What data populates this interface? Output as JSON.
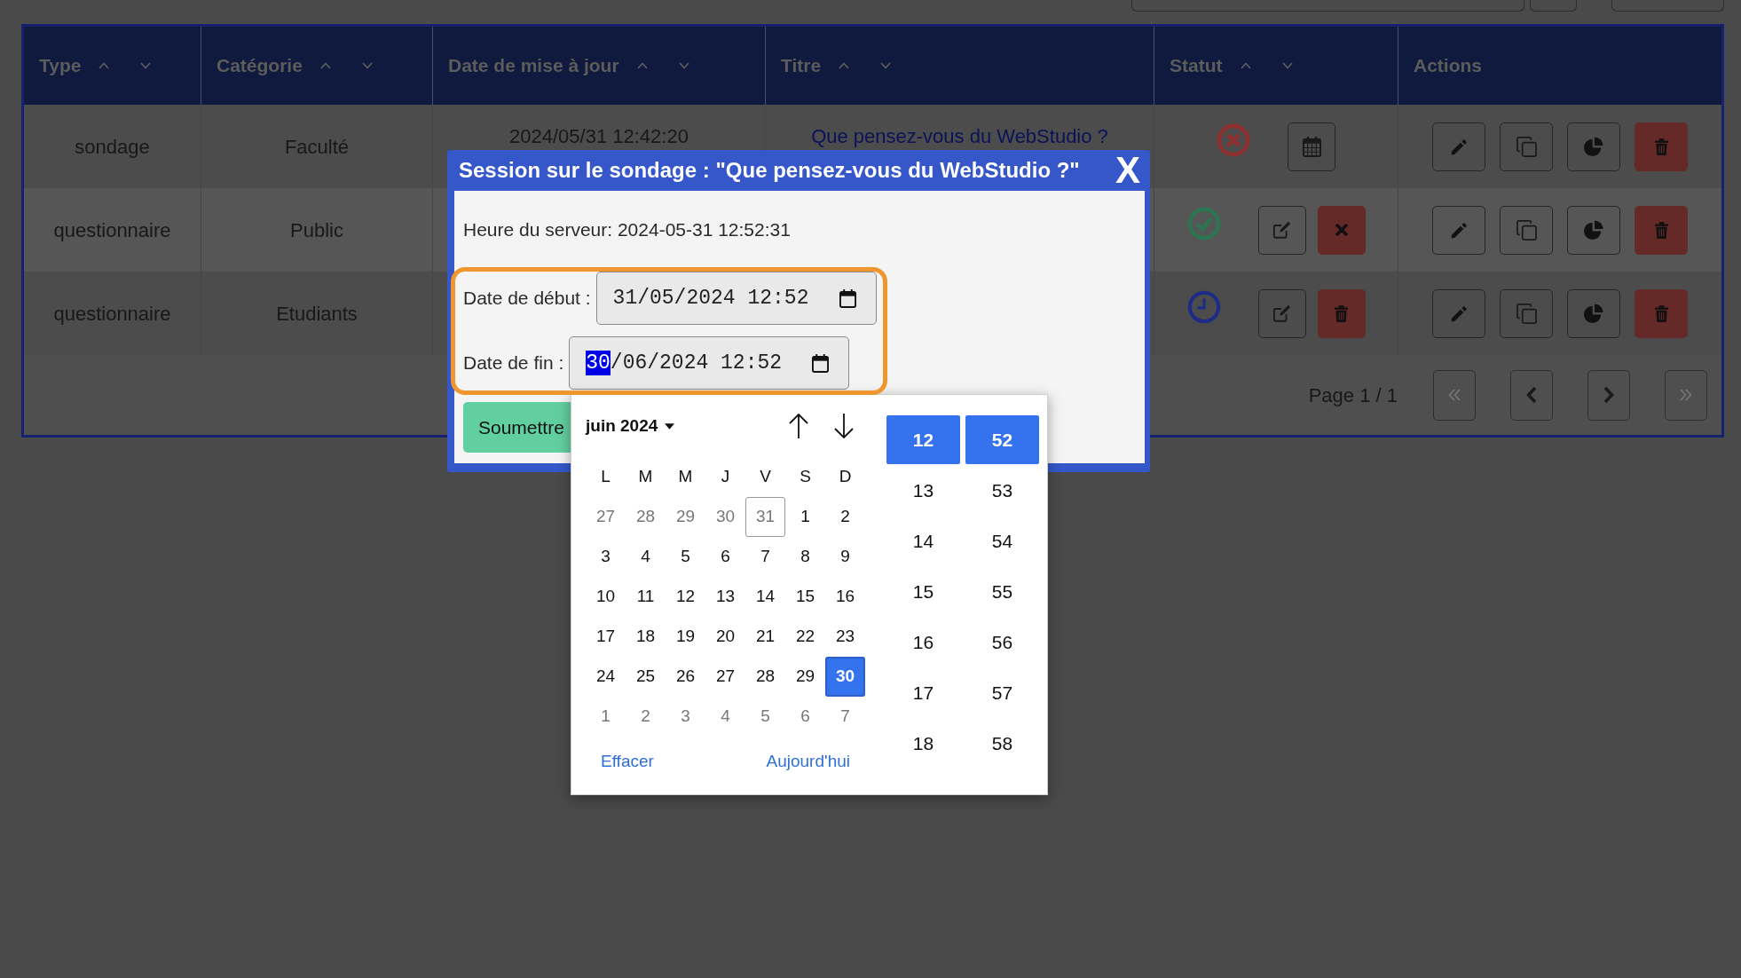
{
  "table": {
    "columns": [
      {
        "label": "Type",
        "sortable": true
      },
      {
        "label": "Catégorie",
        "sortable": true
      },
      {
        "label": "Date de mise à jour",
        "sortable": true
      },
      {
        "label": "Titre",
        "sortable": true
      },
      {
        "label": "Statut",
        "sortable": true
      },
      {
        "label": "Actions",
        "sortable": false
      }
    ],
    "rows": [
      {
        "type": "sondage",
        "category": "Faculté",
        "updated": "2024/05/31 12:42:20",
        "title": "Que pensez-vous du WebStudio ?",
        "kind": "closed"
      },
      {
        "type": "questionnaire",
        "category": "Public",
        "kind": "open"
      },
      {
        "type": "questionnaire",
        "category": "Etudiants",
        "kind": "scheduled"
      }
    ],
    "pagination": {
      "label": "Page 1 / 1"
    }
  },
  "dialog": {
    "title": "Session sur le sondage : \"Que pensez-vous du WebStudio ?\"",
    "close": "X",
    "server_time": "Heure du serveur: 2024-05-31 12:52:31",
    "fields": [
      {
        "label": "Date de début :",
        "segments": [
          {
            "text": "31/05/2024 12:52",
            "selected": false
          }
        ]
      },
      {
        "label": "Date de fin :",
        "segments": [
          {
            "text": "30",
            "selected": true
          },
          {
            "text": "/06/2024 12:52",
            "selected": false
          }
        ]
      }
    ],
    "submit": "Soumettre"
  },
  "date_picker": {
    "month": "juin 2024",
    "weekdays": [
      "L",
      "M",
      "M",
      "J",
      "V",
      "S",
      "D"
    ],
    "weeks": [
      [
        {
          "day": "27",
          "outside": true,
          "today": false,
          "selected": false
        },
        {
          "day": "28",
          "outside": true,
          "today": false,
          "selected": false
        },
        {
          "day": "29",
          "outside": true,
          "today": false,
          "selected": false
        },
        {
          "day": "30",
          "outside": true,
          "today": false,
          "selected": false
        },
        {
          "day": "31",
          "outside": true,
          "today": true,
          "selected": false
        },
        {
          "day": "1",
          "outside": false,
          "today": false,
          "selected": false
        },
        {
          "day": "2",
          "outside": false,
          "today": false,
          "selected": false
        }
      ],
      [
        {
          "day": "3",
          "outside": false,
          "today": false,
          "selected": false
        },
        {
          "day": "4",
          "outside": false,
          "today": false,
          "selected": false
        },
        {
          "day": "5",
          "outside": false,
          "today": false,
          "selected": false
        },
        {
          "day": "6",
          "outside": false,
          "today": false,
          "selected": false
        },
        {
          "day": "7",
          "outside": false,
          "today": false,
          "selected": false
        },
        {
          "day": "8",
          "outside": false,
          "today": false,
          "selected": false
        },
        {
          "day": "9",
          "outside": false,
          "today": false,
          "selected": false
        }
      ],
      [
        {
          "day": "10",
          "outside": false,
          "today": false,
          "selected": false
        },
        {
          "day": "11",
          "outside": false,
          "today": false,
          "selected": false
        },
        {
          "day": "12",
          "outside": false,
          "today": false,
          "selected": false
        },
        {
          "day": "13",
          "outside": false,
          "today": false,
          "selected": false
        },
        {
          "day": "14",
          "outside": false,
          "today": false,
          "selected": false
        },
        {
          "day": "15",
          "outside": false,
          "today": false,
          "selected": false
        },
        {
          "day": "16",
          "outside": false,
          "today": false,
          "selected": false
        }
      ],
      [
        {
          "day": "17",
          "outside": false,
          "today": false,
          "selected": false
        },
        {
          "day": "18",
          "outside": false,
          "today": false,
          "selected": false
        },
        {
          "day": "19",
          "outside": false,
          "today": false,
          "selected": false
        },
        {
          "day": "20",
          "outside": false,
          "today": false,
          "selected": false
        },
        {
          "day": "21",
          "outside": false,
          "today": false,
          "selected": false
        },
        {
          "day": "22",
          "outside": false,
          "today": false,
          "selected": false
        },
        {
          "day": "23",
          "outside": false,
          "today": false,
          "selected": false
        }
      ],
      [
        {
          "day": "24",
          "outside": false,
          "today": false,
          "selected": false
        },
        {
          "day": "25",
          "outside": false,
          "today": false,
          "selected": false
        },
        {
          "day": "26",
          "outside": false,
          "today": false,
          "selected": false
        },
        {
          "day": "27",
          "outside": false,
          "today": false,
          "selected": false
        },
        {
          "day": "28",
          "outside": false,
          "today": false,
          "selected": false
        },
        {
          "day": "29",
          "outside": false,
          "today": false,
          "selected": false
        },
        {
          "day": "30",
          "outside": false,
          "today": false,
          "selected": true
        }
      ],
      [
        {
          "day": "1",
          "outside": true,
          "today": false,
          "selected": false
        },
        {
          "day": "2",
          "outside": true,
          "today": false,
          "selected": false
        },
        {
          "day": "3",
          "outside": true,
          "today": false,
          "selected": false
        },
        {
          "day": "4",
          "outside": true,
          "today": false,
          "selected": false
        },
        {
          "day": "5",
          "outside": true,
          "today": false,
          "selected": false
        },
        {
          "day": "6",
          "outside": true,
          "today": false,
          "selected": false
        },
        {
          "day": "7",
          "outside": true,
          "today": false,
          "selected": false
        }
      ]
    ],
    "actions": [
      "Effacer",
      "Aujourd'hui"
    ],
    "hours": [
      {
        "text": "12",
        "selected": true
      },
      {
        "text": "13",
        "selected": false
      },
      {
        "text": "14",
        "selected": false
      },
      {
        "text": "15",
        "selected": false
      },
      {
        "text": "16",
        "selected": false
      },
      {
        "text": "17",
        "selected": false
      },
      {
        "text": "18",
        "selected": false
      }
    ],
    "minutes": [
      {
        "text": "52",
        "selected": true
      },
      {
        "text": "53",
        "selected": false
      },
      {
        "text": "54",
        "selected": false
      },
      {
        "text": "55",
        "selected": false
      },
      {
        "text": "56",
        "selected": false
      },
      {
        "text": "57",
        "selected": false
      },
      {
        "text": "58",
        "selected": false
      }
    ]
  }
}
